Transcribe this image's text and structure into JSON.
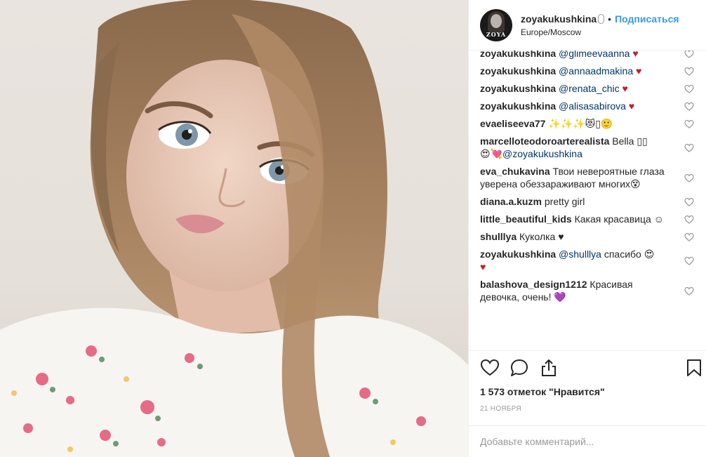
{
  "post": {
    "username": "zoyakukushkina",
    "follow_label": "Подписаться",
    "separator": "•",
    "location": "Europe/Moscow",
    "avatar_logo": "ZOYA"
  },
  "comments": [
    {
      "author": "zoyakukushkina",
      "text": "@glimeevaanna",
      "is_mention": true,
      "emoji": "♥",
      "emoji_color": "red"
    },
    {
      "author": "zoyakukushkina",
      "text": "@annaadmakina",
      "is_mention": true,
      "emoji": "♥",
      "emoji_color": "red"
    },
    {
      "author": "zoyakukushkina",
      "text": "@renata_chic",
      "is_mention": true,
      "emoji": "♥",
      "emoji_color": "red"
    },
    {
      "author": "zoyakukushkina",
      "text": "@alisasabirova",
      "is_mention": true,
      "emoji": "♥",
      "emoji_color": "red"
    },
    {
      "author": "evaeliseeva77",
      "text": "✨✨✨😻▯🙂",
      "is_mention": false,
      "emoji": "",
      "emoji_color": ""
    },
    {
      "author": "marcelloteodoroarterealista",
      "text": "Bella ▯▯",
      "is_mention": false,
      "emoji": "",
      "emoji_color": "",
      "line2_emoji": "😍💘",
      "line2_mention": "@zoyakukushkina"
    },
    {
      "author": "eva_chukavina",
      "text": "Твои невероятные глаза уверена обеззараживают многих😵",
      "is_mention": false,
      "emoji": "",
      "emoji_color": ""
    },
    {
      "author": "diana.a.kuzm",
      "text": "pretty girl",
      "is_mention": false,
      "emoji": "",
      "emoji_color": ""
    },
    {
      "author": "little_beautiful_kids",
      "text": "Какая красавица ☺",
      "is_mention": false,
      "emoji": "",
      "emoji_color": ""
    },
    {
      "author": "shulllya",
      "text": "Куколка ♥",
      "is_mention": false,
      "emoji": "",
      "emoji_color": ""
    },
    {
      "author": "zoyakukushkina",
      "text": "@shulllya",
      "is_mention": true,
      "after_text": " спасибо 😍",
      "emoji": "♥",
      "emoji_color": "red",
      "emoji_newline": true
    },
    {
      "author": "balashova_design1212",
      "text": "Красивая девочка, очень!",
      "is_mention": false,
      "emoji": "💜",
      "emoji_color": "purple"
    }
  ],
  "actions": {
    "likes": "1 573 отметок \"Нравится\"",
    "date": "21 НОЯБРЯ",
    "comment_placeholder": "Добавьте комментарий..."
  },
  "icons": [
    "heart-icon",
    "comment-icon",
    "share-icon",
    "bookmark-icon",
    "like-comment-icon"
  ],
  "colors": {
    "link": "#3897f0",
    "mention": "#003569",
    "heart": "#c0202b",
    "muted": "#999999"
  }
}
